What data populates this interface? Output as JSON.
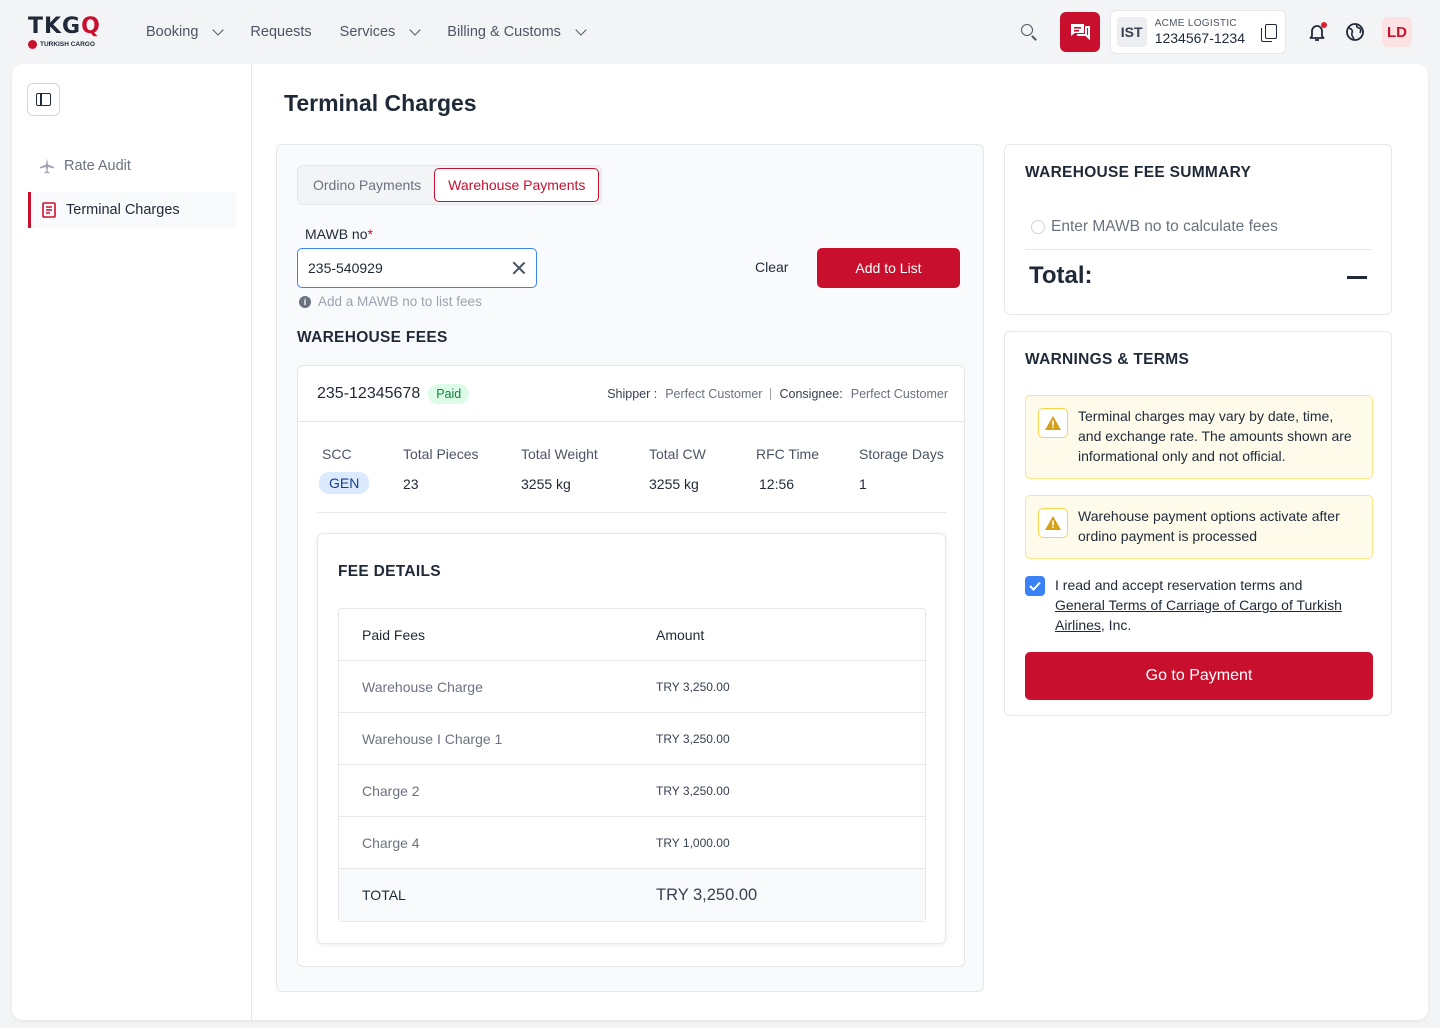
{
  "brand": {
    "logo_main_a": "TKG",
    "logo_main_b": "Q",
    "logo_sub": "TURKISH CARGO"
  },
  "nav": {
    "items": [
      {
        "label": "Booking",
        "dropdown": true
      },
      {
        "label": "Requests",
        "dropdown": false
      },
      {
        "label": "Services",
        "dropdown": true
      },
      {
        "label": "Billing & Customs",
        "dropdown": true
      }
    ]
  },
  "account": {
    "airport": "IST",
    "company": "ACME LOGISTIC",
    "number": "1234567-1234"
  },
  "user": {
    "initials": "LD"
  },
  "sidebar": {
    "items": [
      {
        "label": "Rate Audit",
        "icon": "plane-icon",
        "active": false
      },
      {
        "label": "Terminal Charges",
        "icon": "receipt-icon",
        "active": true
      }
    ]
  },
  "page": {
    "title": "Terminal Charges"
  },
  "tabs": [
    {
      "label": "Ordino Payments",
      "active": false
    },
    {
      "label": "Warehouse Payments",
      "active": true
    }
  ],
  "form": {
    "mawb_label": "MAWB no",
    "required_mark": "*",
    "mawb_value": "235-540929",
    "hint": "Add a MAWB no to list fees",
    "clear_label": "Clear",
    "add_label": "Add to List"
  },
  "warehouse_fees": {
    "heading": "WAREHOUSE FEES",
    "awb": "235-12345678",
    "status": "Paid",
    "shipper_label": "Shipper :",
    "shipper": "Perfect Customer",
    "consignee_label": "Consignee:",
    "consignee": "Perfect Customer",
    "stats": [
      {
        "label": "SCC",
        "value": "GEN"
      },
      {
        "label": "Total Pieces",
        "value": "23"
      },
      {
        "label": "Total Weight",
        "value": "3255 kg"
      },
      {
        "label": "Total CW",
        "value": "3255 kg"
      },
      {
        "label": "RFC Time",
        "value": "12:56"
      },
      {
        "label": "Storage Days",
        "value": "1"
      }
    ]
  },
  "fee_details": {
    "title": "FEE DETAILS",
    "columns": [
      "Paid Fees",
      "Amount"
    ],
    "rows": [
      {
        "name": "Warehouse Charge",
        "amount": "TRY 3,250.00"
      },
      {
        "name": "Warehouse I Charge 1",
        "amount": "TRY 3,250.00"
      },
      {
        "name": "Charge 2",
        "amount": "TRY 3,250.00"
      },
      {
        "name": "Charge 4",
        "amount": "TRY 1,000.00"
      }
    ],
    "total_label": "TOTAL",
    "total_amount": "TRY 3,250.00"
  },
  "summary": {
    "title": "WAREHOUSE FEE SUMMARY",
    "hint": "Enter MAWB no to calculate fees",
    "total_label": "Total:"
  },
  "warnings": {
    "title": "WARNINGS & TERMS",
    "items": [
      "Terminal charges may vary by date, time, and exchange rate. The amounts shown are informational only and not official.",
      "Warehouse payment options activate after ordino payment is processed"
    ],
    "terms_prefix": "I read and accept reservation terms and ",
    "terms_link": "General Terms of Carriage of Cargo of Turkish Airlines",
    "terms_suffix": ", Inc.",
    "terms_checked": true,
    "pay_label": "Go to Payment"
  },
  "colors": {
    "brand": "#c8102e",
    "accent": "#3b82f6",
    "paid": "#15803d"
  }
}
